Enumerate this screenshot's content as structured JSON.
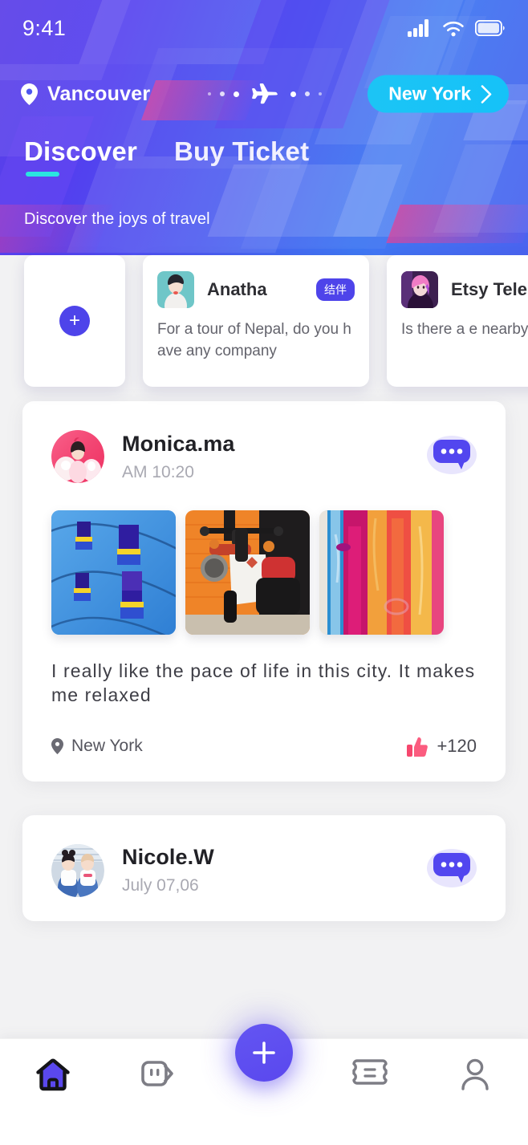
{
  "status_bar": {
    "time": "9:41",
    "icons": [
      "cellular-signal-icon",
      "wifi-icon",
      "battery-icon"
    ]
  },
  "header": {
    "origin": {
      "city": "Vancouver",
      "icon": "location-pin-icon"
    },
    "route": {
      "icon": "airplane-icon",
      "dots": 6
    },
    "destination": {
      "city": "New York",
      "icon": "chevron-right-icon"
    },
    "tabs": [
      {
        "label": "Discover",
        "active": true
      },
      {
        "label": "Buy Ticket",
        "active": false
      }
    ],
    "subtitle": "Discover the joys of travel",
    "accent_underline": "#2ae5e0",
    "gradient_from": "#5b3fe8",
    "gradient_to": "#3f77f2"
  },
  "story_cards": {
    "add_button": {
      "icon": "plus-icon",
      "label": "+"
    },
    "items": [
      {
        "name": "Anatha",
        "badge": "结伴",
        "message": "For a tour of Nepal, do you have any company",
        "avatar": "anatha-avatar"
      },
      {
        "name": "Etsy Tele",
        "badge": "",
        "message": "Is there a  e nearby ",
        "avatar": "etsy-tele-avatar"
      }
    ]
  },
  "feed": {
    "posts": [
      {
        "author": "Monica.ma",
        "timestamp": "AM 10:20",
        "avatar": "monica-avatar",
        "menu_icon": "comment-bubble-icon",
        "photos": [
          "blue-building-windows-photo",
          "orange-scooter-photo",
          "abstract-paint-photo"
        ],
        "text": "I really like the pace of life in this city. It makes me relaxed",
        "location": "New York",
        "location_icon": "location-pin-icon",
        "likes": "+120",
        "likes_icon": "thumbs-up-icon"
      },
      {
        "author": "Nicole.W",
        "timestamp": "July 07,06",
        "avatar": "nicole-avatar",
        "menu_icon": "comment-bubble-icon",
        "photos": [],
        "text": "",
        "location": "",
        "likes": ""
      }
    ]
  },
  "bottom_nav": {
    "items": [
      {
        "name": "home",
        "icon": "home-icon",
        "active": true
      },
      {
        "name": "messages",
        "icon": "message-tag-icon",
        "active": false
      },
      {
        "name": "add",
        "icon": "plus-icon",
        "active": false,
        "is_fab": true
      },
      {
        "name": "tickets",
        "icon": "ticket-icon",
        "active": false
      },
      {
        "name": "profile",
        "icon": "person-icon",
        "active": false
      }
    ],
    "fab_color": "#5a48ee",
    "active_color": "#5a48ee",
    "inactive_color": "#7d7d85"
  }
}
